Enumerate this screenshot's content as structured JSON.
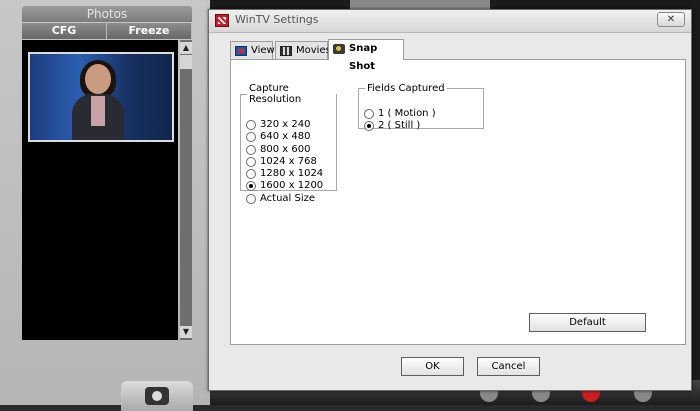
{
  "background_app": {
    "panel_title": "Photos",
    "tabs": [
      "CFG",
      "Freeze"
    ]
  },
  "dialog": {
    "title": "WinTV Settings",
    "close_label": "✕",
    "tabs": [
      {
        "label": "View",
        "active": false
      },
      {
        "label": "Movies",
        "active": false
      },
      {
        "label": "Snap Shot",
        "active": true
      }
    ],
    "capture_resolution": {
      "label": "Capture Resolution",
      "options": [
        {
          "label": "320 x 240",
          "selected": false
        },
        {
          "label": "640 x 480",
          "selected": false
        },
        {
          "label": "800 x 600",
          "selected": false
        },
        {
          "label": "1024 x 768",
          "selected": false
        },
        {
          "label": "1280 x 1024",
          "selected": false
        },
        {
          "label": "1600 x 1200",
          "selected": true
        },
        {
          "label": "Actual Size",
          "selected": false
        }
      ]
    },
    "fields_captured": {
      "label": "Fields Captured",
      "options": [
        {
          "label": "1 ( Motion )",
          "selected": false
        },
        {
          "label": "2 ( Still )",
          "selected": true
        }
      ]
    },
    "default_label": "Default",
    "ok_label": "OK",
    "cancel_label": "Cancel"
  },
  "colors": {
    "dialog_bg": "#e9e9e9",
    "panel_bg": "#ffffff",
    "title_icon": "#c0202a"
  }
}
